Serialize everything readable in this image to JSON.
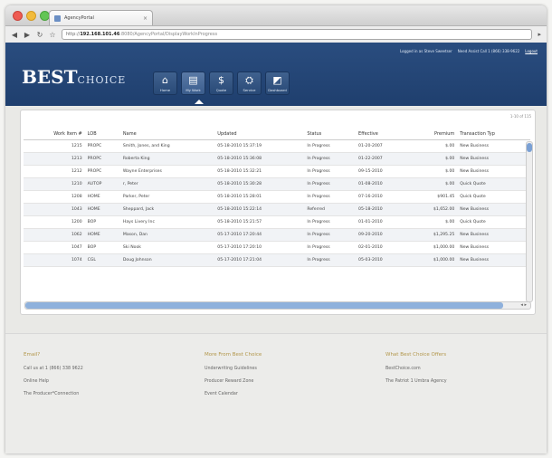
{
  "browser": {
    "tab_title": "AgencyPortal",
    "tab_close": "×",
    "url_scheme": "http://",
    "url_host": "192.168.101.46",
    "url_path": ":8080/AgencyPortal/DisplayWorkInProgress"
  },
  "header": {
    "logo_main": "BEST",
    "logo_sub": "CHOICE",
    "toplinks": [
      "Logged in as Steve Sweetser",
      "Need Assist Call 1 (866) 338-9622",
      "Logout"
    ],
    "nav": [
      {
        "label": "Home",
        "icon": "home-icon",
        "glyph": "⌂"
      },
      {
        "label": "My Work",
        "icon": "briefcase-icon",
        "glyph": "▤"
      },
      {
        "label": "Quote",
        "icon": "dollar-icon",
        "glyph": "$"
      },
      {
        "label": "Service",
        "icon": "service-icon",
        "glyph": "⛭"
      },
      {
        "label": "Dashboard",
        "icon": "dashboard-icon",
        "glyph": "◩"
      }
    ],
    "active_nav": 1
  },
  "worklist": {
    "pager": "1-10 of 115",
    "columns": [
      "Work Item #",
      "LOB",
      "Name",
      "Updated",
      "Status",
      "Effective",
      "Premium",
      "Transaction Typ"
    ],
    "rows": [
      [
        "1215",
        "PROPC",
        "Smith, Jones, and King",
        "05-18-2010 15:37:19",
        "In Progress",
        "01-20-2007",
        "$.00",
        "New Business"
      ],
      [
        "1213",
        "PROPC",
        "Roberta King",
        "05-18-2010 15:36:08",
        "In Progress",
        "01-22-2007",
        "$.00",
        "New Business"
      ],
      [
        "1212",
        "PROPC",
        "Wayne Enterprises",
        "05-18-2010 15:32:21",
        "In Progress",
        "09-15-2010",
        "$.00",
        "New Business"
      ],
      [
        "1210",
        "AUTOP",
        "r, Peter",
        "05-18-2010 15:30:28",
        "In Progress",
        "01-08-2010",
        "$.00",
        "Quick Quote"
      ],
      [
        "1208",
        "HOME",
        "Parker, Peter",
        "05-18-2010 15:28:01",
        "In Progress",
        "07-16-2010",
        "$901.45",
        "Quick Quote"
      ],
      [
        "1043",
        "HOME",
        "Sheppard, Jack",
        "05-18-2010 15:22:14",
        "Referred",
        "05-18-2010",
        "$1,652.00",
        "New Business"
      ],
      [
        "1200",
        "BOP",
        "Hays Livery Inc",
        "05-18-2010 15:21:57",
        "In Progress",
        "01-01-2010",
        "$.00",
        "Quick Quote"
      ],
      [
        "1062",
        "HOME",
        "Mason, Dan",
        "05-17-2010 17:20:44",
        "In Progress",
        "09-20-2010",
        "$1,295.25",
        "New Business"
      ],
      [
        "1047",
        "BOP",
        "Ski Nook",
        "05-17-2010 17:20:10",
        "In Progress",
        "02-01-2010",
        "$1,000.00",
        "New Business"
      ],
      [
        "1074",
        "CGL",
        "Doug Johnson",
        "05-17-2010 17:21:04",
        "In Progress",
        "05-03-2010",
        "$1,000.00",
        "New Business"
      ]
    ]
  },
  "footer": {
    "columns": [
      {
        "heading": "Email?",
        "links": [
          "Call us at 1 (866) 338 9622",
          "Online Help",
          "The Producer*Connection"
        ]
      },
      {
        "heading": "More From Best Choice",
        "links": [
          "Underwriting Guidelines",
          "Producer Reward Zone",
          "Event Calendar"
        ]
      },
      {
        "heading": "What Best Choice Offers",
        "links": [
          "BestChoice.com",
          "The Patriot 1 Umbra Agency"
        ]
      }
    ]
  }
}
